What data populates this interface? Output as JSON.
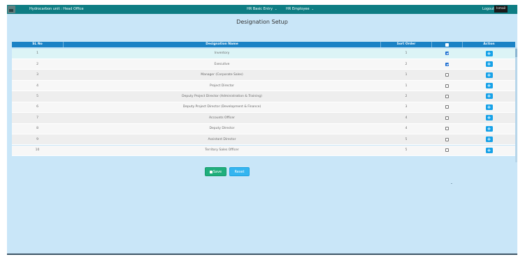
{
  "header": {
    "app_name": "Hydrocarbon unit : Head Office",
    "nav": [
      {
        "label": "HR Basic Entry"
      },
      {
        "label": "HR Employee"
      }
    ],
    "logout_label": "Logout",
    "user_name": "Ismail"
  },
  "page": {
    "title": "Designation Setup"
  },
  "table": {
    "columns": [
      "SL No",
      "Designation Name",
      "Sort Order",
      "",
      "Action"
    ],
    "rows": [
      {
        "sl": "1",
        "name": "Inventory",
        "sort": "1",
        "checked": true
      },
      {
        "sl": "2",
        "name": "Executive",
        "sort": "2",
        "checked": true
      },
      {
        "sl": "3",
        "name": "Manager (Corporate Sales)",
        "sort": "1",
        "checked": false
      },
      {
        "sl": "4",
        "name": "Project Director",
        "sort": "1",
        "checked": false
      },
      {
        "sl": "5",
        "name": "Deputy Project Director (Administration & Training)",
        "sort": "2",
        "checked": false
      },
      {
        "sl": "6",
        "name": "Deputy Project Director (Development & Finance)",
        "sort": "3",
        "checked": false
      },
      {
        "sl": "7",
        "name": "Accounts Officer",
        "sort": "4",
        "checked": false
      },
      {
        "sl": "8",
        "name": "Deputy Director",
        "sort": "4",
        "checked": false
      },
      {
        "sl": "9",
        "name": "Assistant Director",
        "sort": "5",
        "checked": false
      },
      {
        "sl": "10",
        "name": "Territory Sales Officer",
        "sort": "5",
        "checked": false
      }
    ],
    "action_symbol": "+"
  },
  "buttons": {
    "save_label": "Save",
    "reset_label": "Reset"
  },
  "colors": {
    "topbar": "#0e7d83",
    "table_header": "#1b82c5",
    "page_bg": "#c9e6f8",
    "row_highlight": "#dcf4f6",
    "row_odd": "#eeeeee",
    "row_even": "#f7f7f7",
    "save": "#1fae7c",
    "reset": "#34b5f0",
    "action": "#17a2e8"
  }
}
